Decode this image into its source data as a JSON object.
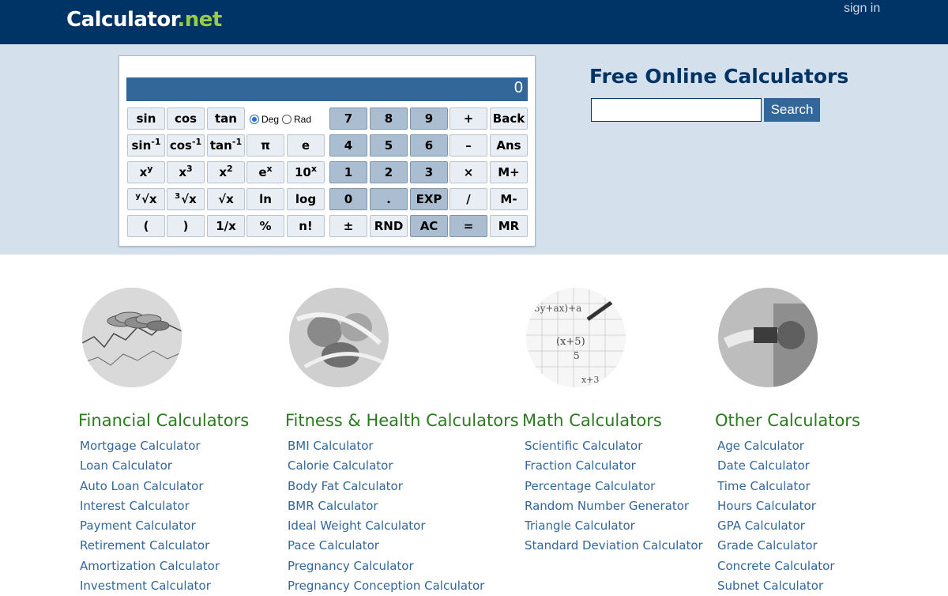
{
  "header": {
    "logo_main": "Calculator",
    "logo_dot": ".",
    "logo_net": "net",
    "signin": "sign in"
  },
  "calculator": {
    "display": "0",
    "angle": {
      "deg": "Deg",
      "rad": "Rad",
      "selected": "Deg"
    },
    "rows": [
      [
        "sin",
        "cos",
        "tan",
        "7",
        "8",
        "9",
        "+",
        "Back"
      ],
      [
        "sin",
        "cos",
        "tan",
        "π",
        "e",
        "4",
        "5",
        "6",
        "–",
        "Ans"
      ],
      [
        "x",
        "x",
        "x",
        "e",
        "10",
        "1",
        "2",
        "3",
        "×",
        "M+"
      ],
      [
        "√x",
        "√x",
        "√x",
        "ln",
        "log",
        "0",
        ".",
        "EXP",
        "/",
        "M-"
      ],
      [
        "(",
        ")",
        "1/x",
        "%",
        "n!",
        "±",
        "RND",
        "AC",
        "=",
        "MR"
      ]
    ],
    "superscripts": {
      "inv": "-1",
      "pow_y": "y",
      "pow3": "3",
      "pow2": "2",
      "exp_x": "x",
      "tenx": "x",
      "root_y": "y",
      "root3": "3"
    }
  },
  "search": {
    "heading": "Free Online Calculators",
    "value": "",
    "button": "Search"
  },
  "categories": [
    {
      "title": "Financial Calculators",
      "links": [
        "Mortgage Calculator",
        "Loan Calculator",
        "Auto Loan Calculator",
        "Interest Calculator",
        "Payment Calculator",
        "Retirement Calculator",
        "Amortization Calculator",
        "Investment Calculator"
      ]
    },
    {
      "title": "Fitness & Health Calculators",
      "links": [
        "BMI Calculator",
        "Calorie Calculator",
        "Body Fat Calculator",
        "BMR Calculator",
        "Ideal Weight Calculator",
        "Pace Calculator",
        "Pregnancy Calculator",
        "Pregnancy Conception Calculator"
      ]
    },
    {
      "title": "Math Calculators",
      "links": [
        "Scientific Calculator",
        "Fraction Calculator",
        "Percentage Calculator",
        "Random Number Generator",
        "Triangle Calculator",
        "Standard Deviation Calculator"
      ]
    },
    {
      "title": "Other Calculators",
      "links": [
        "Age Calculator",
        "Date Calculator",
        "Time Calculator",
        "Hours Calculator",
        "GPA Calculator",
        "Grade Calculator",
        "Concrete Calculator",
        "Subnet Calculator"
      ]
    }
  ],
  "math_image_text": {
    "line1": "5y+ax)+a",
    "line2": "(x+5)",
    "line3": "5",
    "line4": "x+3"
  },
  "colors": {
    "header_bg": "#003366",
    "hero_bg": "#d4e0ec",
    "accent": "#336699",
    "category_title": "#2b7a1f",
    "link": "#336699",
    "logo_net": "#99cc44"
  }
}
